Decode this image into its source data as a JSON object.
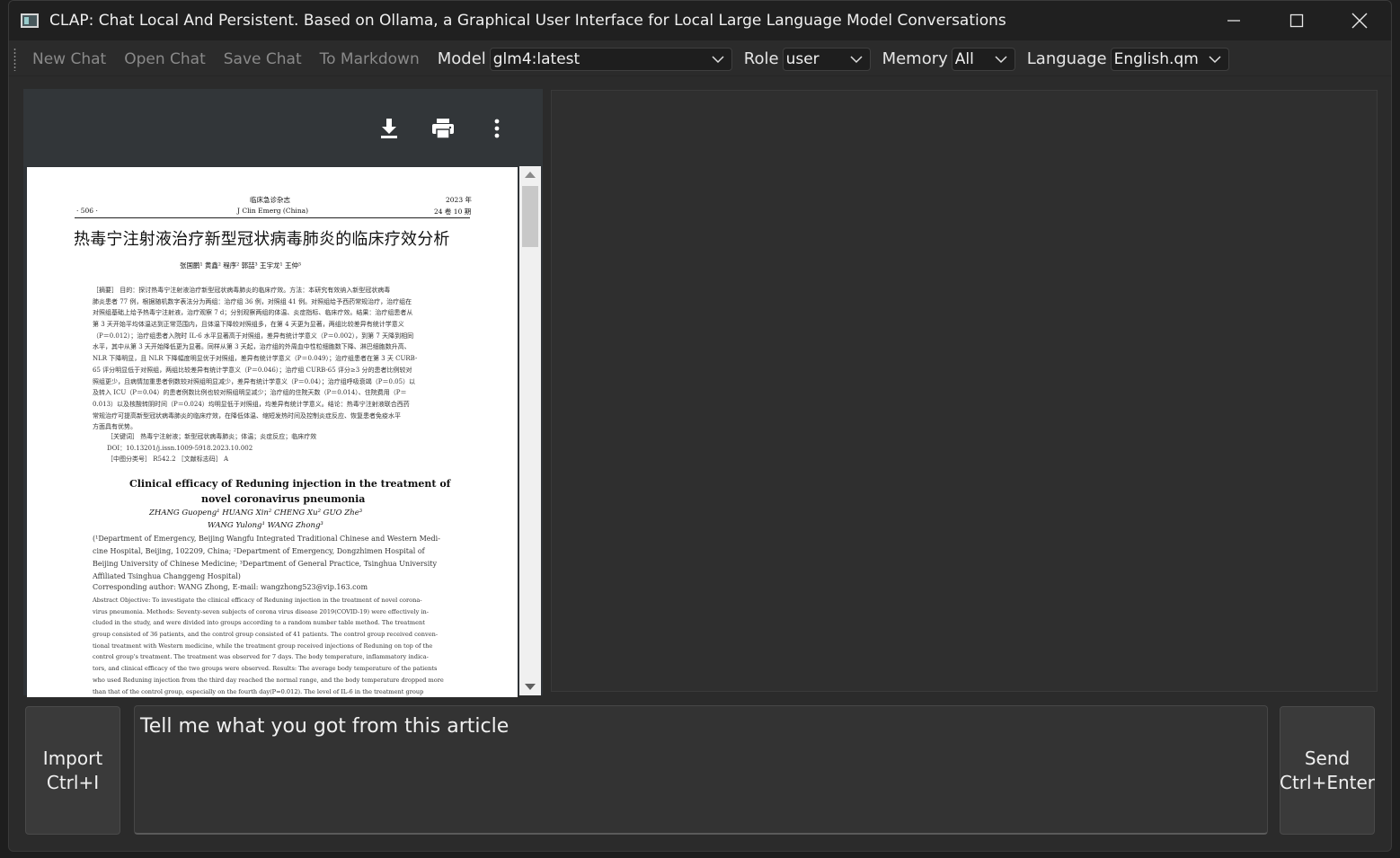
{
  "window": {
    "title": "CLAP: Chat Local And Persistent. Based on Ollama, a Graphical User Interface for Local Large Language Model Conversations"
  },
  "toolbar": {
    "new_chat": "New Chat",
    "open_chat": "Open Chat",
    "save_chat": "Save Chat",
    "to_markdown": "To Markdown",
    "model_label": "Model",
    "model_value": "glm4:latest",
    "role_label": "Role",
    "role_value": "user",
    "memory_label": "Memory",
    "memory_value": "All",
    "language_label": "Language",
    "language_value": "English.qm"
  },
  "pdf": {
    "header_center_cn": "临床急诊杂志",
    "header_center_en": "J Clin Emerg (China)",
    "header_year": "2023 年",
    "header_vol": "24 卷 10 期",
    "page_number": "· 506 ·",
    "title_cn": "热毒宁注射液治疗新型冠状病毒肺炎的临床疗效分析",
    "authors_cn": "张国鹏¹   黄鑫²   程序²   郭喆³   王宇龙¹   王仲³",
    "abstract_cn": [
      "［摘要］ 目的：探讨热毒宁注射液治疗新型冠状病毒肺炎的临床疗效。方法：本研究有效纳入新型冠状病毒",
      "肺炎患者 77 例，根据随机数字表法分为两组：治疗组 36 例，对照组 41 例。对照组给予西药常规治疗，治疗组在",
      "对照组基础上给予热毒宁注射液，治疗观察 7 d；分别观察两组的体温、炎症指标、临床疗效。结果：治疗组患者从",
      "第 3 天开始平均体温达到正常范围内，且体温下降较对照组多，在第 4 天更为显著，两组比较差异有统计学意义",
      "（P＝0.012）；治疗组患者入院时 IL-6 水平显著高于对照组，差异有统计学意义（P＝0.002），到第 7 天降到相同",
      "水平，其中从第 3 天开始降低更为显著。同样从第 3 天起，治疗组的外周血中性粒细胞数下降、淋巴细胞数升高、",
      "NLR 下降明显，且 NLR 下降幅度明显优于对照组，差异有统计学意义（P＝0.049）；治疗组患者在第 3 天 CURB-",
      "65 评分明显低于对照组，两组比较差异有统计学意义（P＝0.046）；治疗组 CURB-65 评分≥3 分的患者比例较对",
      "照组更少，且病情加重患者例数较对照组明显减少，差异有统计学意义（P＝0.04）；治疗组呼吸衰竭（P＝0.05）以",
      "及转入 ICU（P＝0.04）的患者例数比例也较对照组明显减少；治疗组的住院天数（P＝0.014）、住院费用（P＝",
      "0.013）以及核酸转阴时间（P＝0.024）均明显低于对照组，均差异有统计学意义。结论：热毒宁注射液联合西药",
      "常规治疗可提高新型冠状病毒肺炎的临床疗效，在降低体温、缩短发热时间及控制炎症反应、恢复患者免疫水平",
      "方面具有优势。"
    ],
    "keywords_cn": "［关键词］ 热毒宁注射液；新型冠状病毒肺炎；体温；炎症反应；临床疗效",
    "doi": "DOI：10.13201/j.issn.1009-5918.2023.10.002",
    "classification": "［中图分类号］ R542.2    ［文献标志码］ A",
    "title_en_1": "Clinical efficacy of Reduning injection in the treatment of",
    "title_en_2": "novel coronavirus pneumonia",
    "authors_en_1": "ZHANG Guopeng¹   HUANG Xin²   CHENG Xu²   GUO Zhe³",
    "authors_en_2": "WANG Yulong¹   WANG Zhong³",
    "affiliations": [
      "(¹Department of Emergency, Beijing Wangfu Integrated Traditional Chinese and Western Medi-",
      "cine Hospital, Beijing, 102209, China; ²Department of Emergency, Dongzhimen Hospital of",
      "Beijing University of Chinese Medicine; ³Department of General Practice, Tsinghua University",
      "Affiliated Tsinghua Changgeng Hospital)"
    ],
    "corresponding": "Corresponding author: WANG Zhong, E-mail: wangzhong523@vip.163.com",
    "abstract_en": [
      "Abstract  Objective: To investigate the clinical efficacy of Reduning injection in the treatment of novel corona-",
      "virus pneumonia. Methods: Seventy-seven subjects of corona virus disease 2019(COVID-19) were effectively in-",
      "cluded in the study, and were divided into groups according to a random number table method. The treatment",
      "group consisted of 36 patients, and the control group consisted of 41 patients. The control group received conven-",
      "tional treatment with Western medicine, while the treatment group received injections of Reduning on top of the",
      "control group's treatment. The treatment was observed for 7 days. The body temperature, inflammatory indica-",
      "tors, and clinical efficacy of the two groups were observed. Results: The average body temperature of the patients",
      "who used Reduning injection from the third day reached the normal range, and the body temperature dropped more",
      "than that of the control group, especially on the fourth day(P=0.012). The level of IL-6 in the treatment group"
    ]
  },
  "input": {
    "text": "Tell me what you got from this article"
  },
  "buttons": {
    "import_label": "Import\nCtrl+I",
    "send_label": "Send\nCtrl+Enter"
  }
}
